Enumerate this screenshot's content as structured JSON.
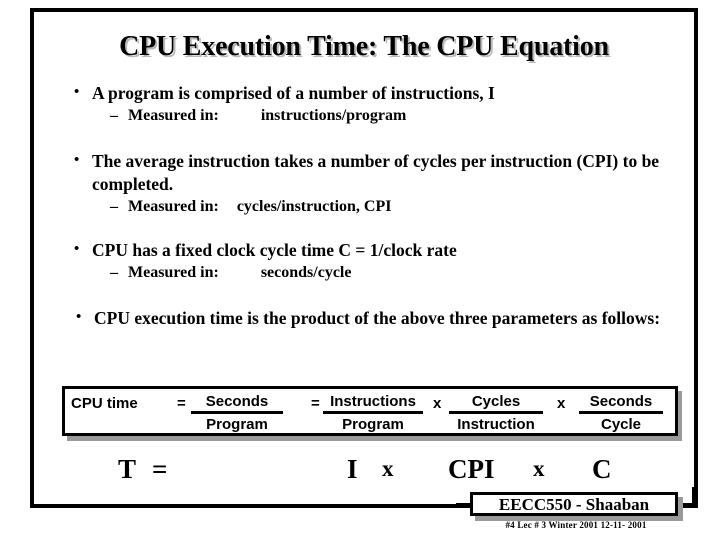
{
  "slide": {
    "title": "CPU Execution Time: The CPU Equation",
    "bullets": [
      {
        "marker": "•",
        "text": "A program is comprised of a number of instructions,  I",
        "sub": [
          {
            "marker": "–",
            "label": "Measured in:",
            "value": "instructions/program"
          }
        ]
      },
      {
        "marker": "•",
        "text": "The average instruction takes a number of cycles per instruction (CPI) to be completed.",
        "sub": [
          {
            "marker": "–",
            "label": "Measured in:",
            "value": "cycles/instruction,  CPI"
          }
        ]
      },
      {
        "marker": "•",
        "text": "CPU has a fixed clock cycle time  C  = 1/clock rate",
        "sub": [
          {
            "marker": "–",
            "label": "Measured in:",
            "value": "seconds/cycle"
          }
        ]
      },
      {
        "marker": "•",
        "text": "CPU execution time is the product of the above three parameters as follows:",
        "sub": []
      }
    ]
  },
  "equation_box": {
    "lead": "CPU time",
    "equals_1": "=",
    "fraction_1": {
      "numerator": "Seconds",
      "denominator": "Program"
    },
    "equals_2": "=",
    "fraction_2": {
      "numerator": "Instructions",
      "denominator": "Program"
    },
    "times_1": "x",
    "fraction_3": {
      "numerator": "Cycles",
      "denominator": "Instruction"
    },
    "times_2": "x",
    "fraction_4": {
      "numerator": "Seconds",
      "denominator": "Cycle"
    }
  },
  "formula": {
    "t": "T",
    "equals": "=",
    "i": "I",
    "times_1": "x",
    "cpi": "CPI",
    "times_2": "x",
    "c": "C"
  },
  "footer": {
    "badge": "EECC550 - Shaaban",
    "meta": "#4   Lec # 3    Winter 2001    12-11- 2001"
  },
  "colors": {
    "text": "#000000",
    "background": "#ffffff",
    "shadow": "#9a9a9a",
    "title_shadow": "#b9b9b9"
  }
}
